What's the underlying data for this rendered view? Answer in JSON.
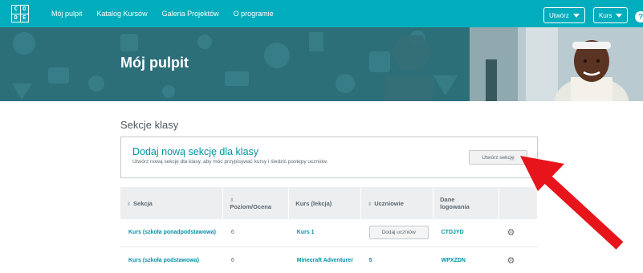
{
  "nav": {
    "logo_letters": [
      "C",
      "O",
      "D",
      "E"
    ],
    "links": [
      "Mój pulpit",
      "Katalog Kursów",
      "Galeria Projektów",
      "O programie"
    ],
    "create_label": "Utwórz",
    "course_label": "Kurs",
    "help_glyph": "?",
    "bg_color": "#00adbc"
  },
  "banner": {
    "title": "Mój pulpit",
    "bg_color": "#2c6f79"
  },
  "sections": {
    "heading": "Sekcje klasy",
    "add_box": {
      "title": "Dodaj nową sekcję dla klasy",
      "subtitle": "Utwórz nową sekcję dla klasy, aby móc przypisywać kursy i śledzić postępy uczniów.",
      "button_label": "Utwórz sekcję"
    },
    "table": {
      "headers": {
        "section": "Sekcja",
        "level": "Poziom/Ocena",
        "course": "Kurs (lekcja)",
        "students": "Uczniowie",
        "login": "Dane logowania"
      },
      "rows": [
        {
          "section": "Kurs (szkoła ponadpodstawowa)",
          "level": "6",
          "course": "Kurs 1",
          "students": "Dodaj uczniów",
          "login": "CTDJYD"
        },
        {
          "section": "Kurs (szkoła podstawowa)",
          "level": "6",
          "course": "Minecraft Adventurer",
          "students": "5",
          "login": "WPXZDN"
        }
      ],
      "gear_glyph": "⚙",
      "sort_glyph": "⇕"
    }
  },
  "accent": {
    "link_color": "#0094a6",
    "arrow_color": "#e8141b"
  }
}
